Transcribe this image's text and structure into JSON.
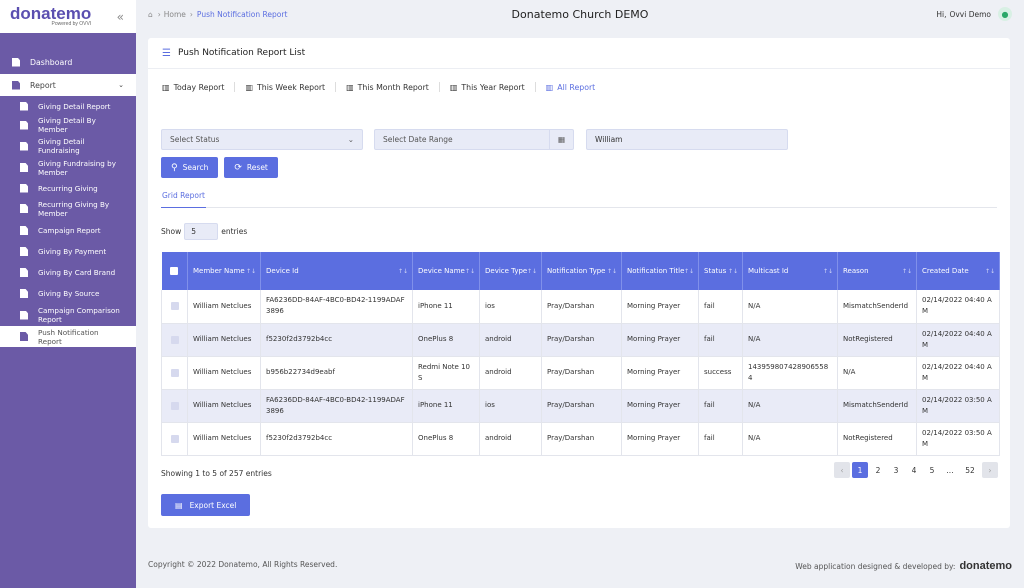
{
  "brand": {
    "logo": "donatemo",
    "tagline": "Powered by OVVI"
  },
  "app_title": "Donatemo Church DEMO",
  "breadcrumb": {
    "home": "Home",
    "current": "Push Notification Report"
  },
  "user": {
    "greeting": "Hi,",
    "name": "Ovvi Demo"
  },
  "sidebar": {
    "dashboard": "Dashboard",
    "report": "Report",
    "items": [
      "Giving Detail Report",
      "Giving Detail By Member",
      "Giving Detail Fundraising",
      "Giving Fundraising by Member",
      "Recurring Giving",
      "Recurring Giving By Member",
      "Campaign Report",
      "Giving By Payment",
      "Giving By Card Brand",
      "Giving By Source",
      "Campaign Comparison Report",
      "Push Notification Report"
    ]
  },
  "card": {
    "title": "Push Notification Report List"
  },
  "tabs": [
    "Today Report",
    "This Week Report",
    "This Month Report",
    "This Year Report",
    "All Report"
  ],
  "filters": {
    "status_placeholder": "Select Status",
    "date_placeholder": "Select Date Range",
    "search_value": "William"
  },
  "buttons": {
    "search": "Search",
    "reset": "Reset",
    "export": "Export Excel"
  },
  "grid_tab": "Grid Report",
  "show": {
    "label": "Show",
    "value": "5",
    "suffix": "entries"
  },
  "table": {
    "columns": [
      "Member Name",
      "Device Id",
      "Device Name",
      "Device Type",
      "Notification Type",
      "Notification Title",
      "Status",
      "Multicast Id",
      "Reason",
      "Created Date"
    ],
    "rows": [
      [
        "William Netclues",
        "FA6236DD-84AF-4BC0-BD42-1199ADAF3896",
        "iPhone 11",
        "ios",
        "Pray/Darshan",
        "Morning Prayer",
        "fail",
        "N/A",
        "MismatchSenderId",
        "02/14/2022 04:40 AM"
      ],
      [
        "William Netclues",
        "f5230f2d3792b4cc",
        "OnePlus 8",
        "android",
        "Pray/Darshan",
        "Morning Prayer",
        "fail",
        "N/A",
        "NotRegistered",
        "02/14/2022 04:40 AM"
      ],
      [
        "William Netclues",
        "b956b22734d9eabf",
        "Redmi Note 10S",
        "android",
        "Pray/Darshan",
        "Morning Prayer",
        "success",
        "1439598074289065584",
        "N/A",
        "02/14/2022 04:40 AM"
      ],
      [
        "William Netclues",
        "FA6236DD-84AF-4BC0-BD42-1199ADAF3896",
        "iPhone 11",
        "ios",
        "Pray/Darshan",
        "Morning Prayer",
        "fail",
        "N/A",
        "MismatchSenderId",
        "02/14/2022 03:50 AM"
      ],
      [
        "William Netclues",
        "f5230f2d3792b4cc",
        "OnePlus 8",
        "android",
        "Pray/Darshan",
        "Morning Prayer",
        "fail",
        "N/A",
        "NotRegistered",
        "02/14/2022 03:50 AM"
      ]
    ]
  },
  "showing": "Showing 1 to 5 of 257 entries",
  "pagination": {
    "pages": [
      "1",
      "2",
      "3",
      "4",
      "5",
      "...",
      "52"
    ],
    "prev": "‹",
    "next": "›"
  },
  "footer": {
    "copyright": "Copyright © 2022 Donatemo, All Rights Reserved.",
    "credit": "Web application designed & developed by:",
    "credit_logo": "donatemo"
  },
  "colors": {
    "sidebar": "#6b5aa6",
    "accent": "#5b6ee0",
    "alt_row": "#e9ebf7"
  }
}
